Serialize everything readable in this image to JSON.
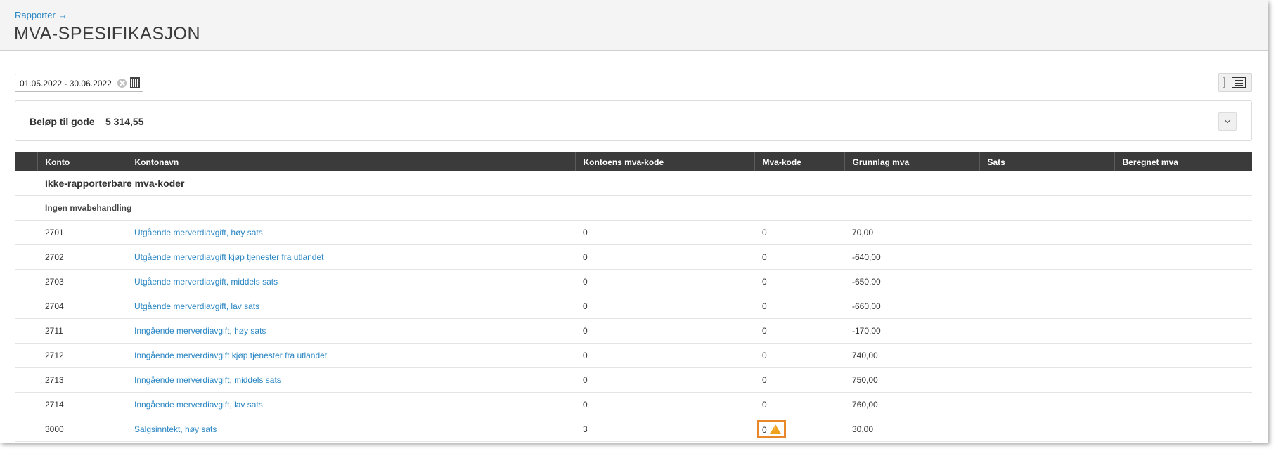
{
  "breadcrumb": {
    "label": "Rapporter",
    "arrow": "→"
  },
  "title": "MVA-SPESIFIKASJON",
  "date_range": {
    "value": "01.05.2022 - 30.06.2022"
  },
  "summary": {
    "label": "Beløp til gode",
    "value": "5 314,55"
  },
  "table": {
    "headers": [
      "Konto",
      "Kontonavn",
      "Kontoens mva-kode",
      "Mva-kode",
      "Grunnlag mva",
      "Sats",
      "Beregnet mva"
    ],
    "group_title": "Ikke-rapporterbare mva-koder",
    "subgroup_title": "Ingen mvabehandling",
    "rows": [
      {
        "konto": "2701",
        "kontonavn": "Utgående merverdiavgift, høy sats",
        "kontoens_mva_kode": "0",
        "mva_kode": "0",
        "grunnlag": "70,00",
        "sats": "",
        "beregnet": ""
      },
      {
        "konto": "2702",
        "kontonavn": "Utgående merverdiavgift kjøp tjenester fra utlandet",
        "kontoens_mva_kode": "0",
        "mva_kode": "0",
        "grunnlag": "-640,00",
        "sats": "",
        "beregnet": ""
      },
      {
        "konto": "2703",
        "kontonavn": "Utgående merverdiavgift, middels sats",
        "kontoens_mva_kode": "0",
        "mva_kode": "0",
        "grunnlag": "-650,00",
        "sats": "",
        "beregnet": ""
      },
      {
        "konto": "2704",
        "kontonavn": "Utgående merverdiavgift, lav sats",
        "kontoens_mva_kode": "0",
        "mva_kode": "0",
        "grunnlag": "-660,00",
        "sats": "",
        "beregnet": ""
      },
      {
        "konto": "2711",
        "kontonavn": "Inngående merverdiavgift, høy sats",
        "kontoens_mva_kode": "0",
        "mva_kode": "0",
        "grunnlag": "-170,00",
        "sats": "",
        "beregnet": ""
      },
      {
        "konto": "2712",
        "kontonavn": "Inngående merverdiavgift kjøp tjenester fra utlandet",
        "kontoens_mva_kode": "0",
        "mva_kode": "0",
        "grunnlag": "740,00",
        "sats": "",
        "beregnet": ""
      },
      {
        "konto": "2713",
        "kontonavn": "Inngående merverdiavgift, middels sats",
        "kontoens_mva_kode": "0",
        "mva_kode": "0",
        "grunnlag": "750,00",
        "sats": "",
        "beregnet": ""
      },
      {
        "konto": "2714",
        "kontonavn": "Inngående merverdiavgift, lav sats",
        "kontoens_mva_kode": "0",
        "mva_kode": "0",
        "grunnlag": "760,00",
        "sats": "",
        "beregnet": ""
      },
      {
        "konto": "3000",
        "kontonavn": "Salgsinntekt, høy sats",
        "kontoens_mva_kode": "3",
        "mva_kode": "0",
        "grunnlag": "30,00",
        "sats": "",
        "beregnet": "",
        "warning_icon": "warning-triangle-icon"
      }
    ]
  },
  "colors": {
    "link": "#2a86c3",
    "header_bg": "#3b3b3b",
    "warning": "#f0a21c",
    "highlight_border": "#e8882b"
  }
}
